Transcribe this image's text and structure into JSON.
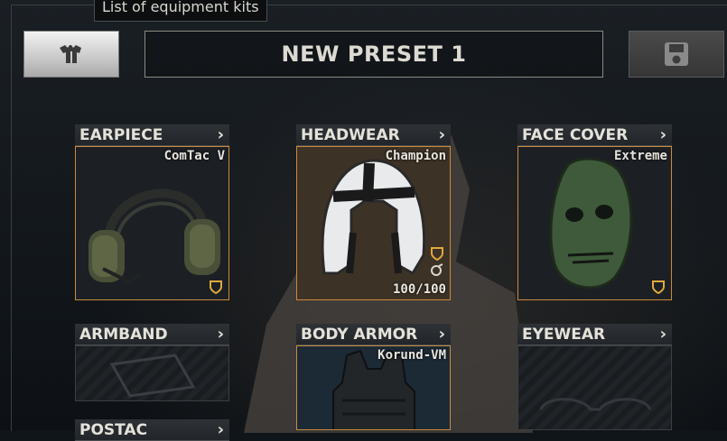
{
  "tooltip": "List of equipment kits",
  "preset_name": "NEW PRESET 1",
  "icons": {
    "kits": "shirt-icon",
    "save": "save-icon",
    "protection": "shield-icon",
    "mod": "gear-icon",
    "chevron": "chevron-right-icon"
  },
  "colors": {
    "accent": "#c98a3c",
    "header_bg": "#2a2e32"
  },
  "slots": {
    "earpiece": {
      "label": "EARPIECE",
      "item": "ComTac V"
    },
    "headwear": {
      "label": "HEADWEAR",
      "item": "Champion",
      "durability": "100/100"
    },
    "face_cover": {
      "label": "FACE COVER",
      "item": "Extreme"
    },
    "armband": {
      "label": "ARMBAND"
    },
    "body_armor": {
      "label": "BODY ARMOR",
      "item": "Korund-VM"
    },
    "eyewear": {
      "label": "EYEWEAR"
    },
    "pouch": {
      "label": "POSTAC"
    }
  }
}
